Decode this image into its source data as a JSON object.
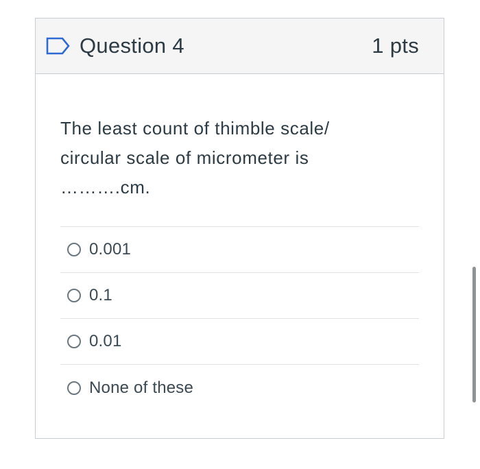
{
  "question": {
    "title": "Question 4",
    "points": "1 pts",
    "flag_icon": "flag-outline-icon",
    "text_lines": [
      "The least count of thimble scale/",
      "circular scale of micrometer is",
      "……….cm."
    ]
  },
  "answers": [
    {
      "label": "0.001",
      "selected": false
    },
    {
      "label": "0.1",
      "selected": false
    },
    {
      "label": "0.01",
      "selected": false
    },
    {
      "label": "None of these",
      "selected": false
    }
  ],
  "colors": {
    "header_background": "#f5f5f5",
    "border": "#c7cdd1",
    "text": "#2d3b45",
    "flag_icon": "#2d6bd3",
    "scrollbar": "#8e9396"
  }
}
